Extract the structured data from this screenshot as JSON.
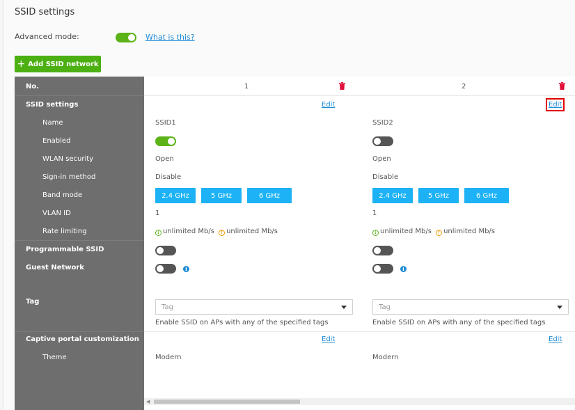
{
  "header": {
    "title": "SSID settings",
    "advanced_mode_label": "Advanced mode:",
    "advanced_mode_on": true,
    "what_is_this": "What is this?",
    "add_button": "Add SSID network"
  },
  "rows": {
    "no": "No.",
    "ssid_settings": "SSID settings",
    "name": "Name",
    "enabled": "Enabled",
    "wlan_security": "WLAN security",
    "sign_in_method": "Sign-in method",
    "band_mode": "Band mode",
    "vlan_id": "VLAN ID",
    "rate_limiting": "Rate limiting",
    "programmable_ssid": "Programmable SSID",
    "guest_network": "Guest Network",
    "tag": "Tag",
    "captive_portal": "Captive portal customization",
    "theme": "Theme"
  },
  "networks": [
    {
      "no": "1",
      "edit": "Edit",
      "name": "SSID1",
      "enabled": true,
      "security": "Open",
      "sign_in": "Disable",
      "bands": [
        "2.4 GHz",
        "5 GHz",
        "6 GHz"
      ],
      "vlan": "1",
      "rate_down": "unlimited Mb/s",
      "rate_up": "unlimited Mb/s",
      "programmable": false,
      "guest": false,
      "tag_placeholder": "Tag",
      "tag_hint": "Enable SSID on APs with any of the specified tags",
      "portal_edit": "Edit",
      "theme": "Modern"
    },
    {
      "no": "2",
      "edit": "Edit",
      "name": "SSID2",
      "enabled": false,
      "security": "Open",
      "sign_in": "Disable",
      "bands": [
        "2.4 GHz",
        "5 GHz",
        "6 GHz"
      ],
      "vlan": "1",
      "rate_down": "unlimited Mb/s",
      "rate_up": "unlimited Mb/s",
      "programmable": false,
      "guest": false,
      "tag_placeholder": "Tag",
      "tag_hint": "Enable SSID on APs with any of the specified tags",
      "portal_edit": "Edit",
      "theme": "Modern"
    }
  ],
  "colors": {
    "accent_green": "#5cb318",
    "band_blue": "#1cb2f5",
    "link_blue": "#1e8cd6",
    "delete_red": "#e0103a",
    "highlight_red": "#e00000"
  }
}
